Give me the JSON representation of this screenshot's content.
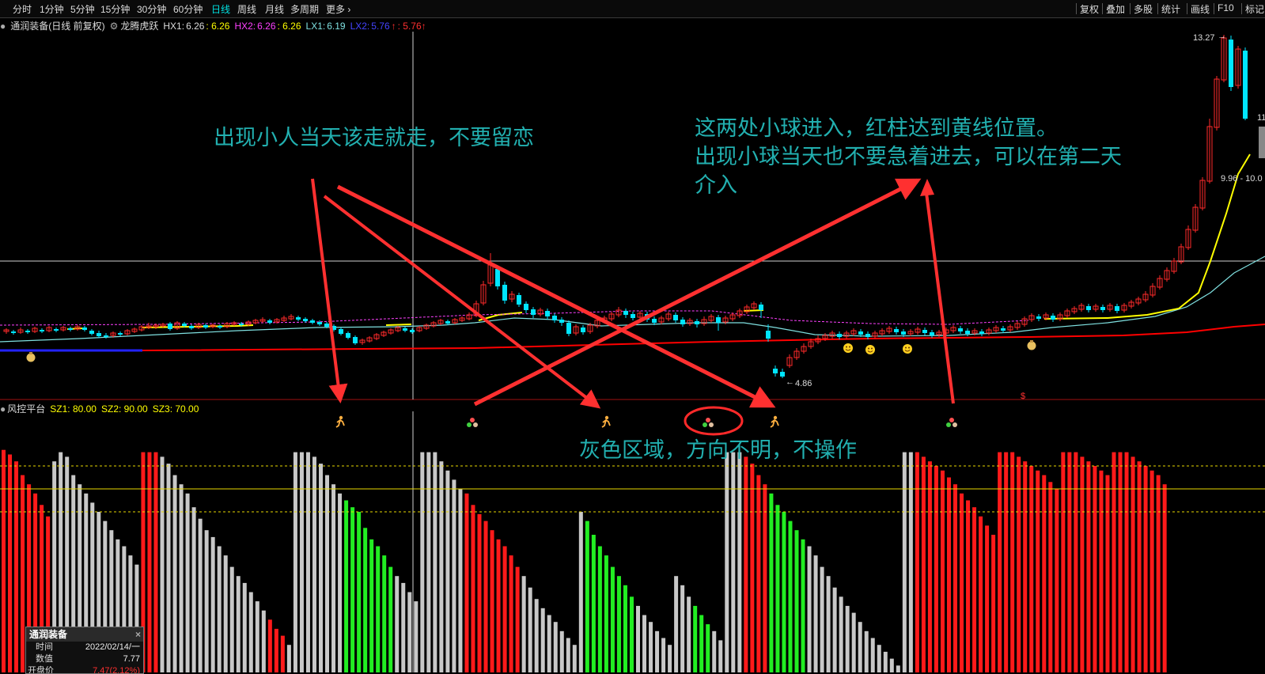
{
  "toolbar": {
    "periods": [
      "分时",
      "1分钟",
      "5分钟",
      "15分钟",
      "30分钟",
      "60分钟",
      "日线",
      "周线",
      "月线",
      "多周期",
      "更多"
    ],
    "active_period": "日线",
    "right_tools": [
      "复权",
      "叠加",
      "多股",
      "统计",
      "画线",
      "F10",
      "标记"
    ]
  },
  "main_indicator": {
    "stock_name": "通润装备",
    "adjust_mode": "(日线 前复权)",
    "indicator_name": "龙腾虎跃",
    "hx1_label": "HX1:",
    "hx1_value": "6.26",
    "hx1_extra": ": 6.26",
    "hx2_label": "HX2:",
    "hx2_value": "6.26",
    "hx2_extra": ": 6.26",
    "lx1_label": "LX1:",
    "lx1_value": "6.19",
    "lx2_label": "LX2:",
    "lx2_value": "5.76",
    "lx2_extra": ": 5.76"
  },
  "sub_indicator": {
    "name": "风控平台",
    "sz1": "SZ1: 80.00",
    "sz2": "SZ2: 90.00",
    "sz3": "SZ3: 70.00"
  },
  "price_labels": {
    "high": "13.27",
    "low": "4.86",
    "right_range": "9.96 - 10.0",
    "right_partial": "11"
  },
  "annotations": {
    "left_note": "出现小人当天该走就走，不要留恋",
    "right_note_line1": "这两处小球进入，红柱达到黄线位置。",
    "right_note_line2": "出现小球当天也不要急着进去，可以在第二天",
    "right_note_line3": "介入",
    "middle_note": "灰色区域，方向不明，不操作"
  },
  "popup": {
    "title": "通润装备",
    "close": "×",
    "rows": [
      {
        "label": "时间",
        "value": "2022/02/14/一"
      },
      {
        "label": "数值",
        "value": "7.77"
      },
      {
        "label": "开盘价",
        "value": "7.47(2.12%)"
      }
    ]
  },
  "colors": {
    "up": "#ff2a2a",
    "down": "#00e5ff",
    "hx_yellow": "#ffff00",
    "hx2_magenta": "#ff40ff",
    "lx1_cyan": "#7fe0e0",
    "lx2_blue": "#2222ff",
    "lx_red": "#ff0000",
    "bar_red": "#ff1a1a",
    "bar_gray": "#c8c8c8",
    "bar_green": "#22ee22",
    "annotation": "#22b0b0",
    "arrow": "#ff3030"
  },
  "chart_data": {
    "type": "bar",
    "description_series": "risk-control platform columns",
    "sz_levels": [
      80,
      90,
      70
    ],
    "ylim": [
      0,
      100
    ],
    "series": [
      {
        "name": "SZ",
        "values": [
          97,
          95,
          92,
          86,
          82,
          78,
          73,
          68,
          92,
          96,
          94,
          86,
          82,
          78,
          74,
          70,
          66,
          62,
          58,
          55,
          51,
          47,
          96,
          96,
          96,
          94,
          91,
          86,
          82,
          78,
          72,
          67,
          62,
          59,
          55,
          51,
          46,
          42,
          39,
          35,
          31,
          27,
          23,
          19,
          16,
          12,
          96,
          96,
          96,
          94,
          91,
          86,
          82,
          78,
          75,
          72,
          70,
          63,
          58,
          55,
          51,
          46,
          42,
          39,
          35,
          31,
          96,
          96,
          96,
          92,
          88,
          84,
          80,
          78,
          73,
          69,
          66,
          62,
          58,
          55,
          51,
          46,
          42,
          37,
          32,
          28,
          25,
          22,
          18,
          15,
          12,
          70,
          66,
          60,
          55,
          51,
          46,
          42,
          38,
          33,
          29,
          25,
          22,
          18,
          15,
          12,
          42,
          38,
          33,
          29,
          25,
          21,
          18,
          14,
          96,
          96,
          96,
          94,
          91,
          86,
          82,
          78,
          73,
          70,
          66,
          62,
          58,
          55,
          51,
          46,
          42,
          37,
          33,
          29,
          26,
          22,
          18,
          15,
          12,
          9,
          6,
          3,
          96,
          96,
          96,
          94,
          92,
          90,
          88,
          85,
          82,
          78,
          75,
          72,
          68,
          64,
          60,
          96,
          96,
          96,
          94,
          92,
          90,
          88,
          86,
          83,
          80,
          96,
          96,
          96,
          94,
          92,
          90,
          88,
          86,
          96,
          96,
          96,
          94,
          92,
          90,
          88,
          86,
          82
        ]
      },
      {
        "name": "colors",
        "values": []
      }
    ]
  }
}
